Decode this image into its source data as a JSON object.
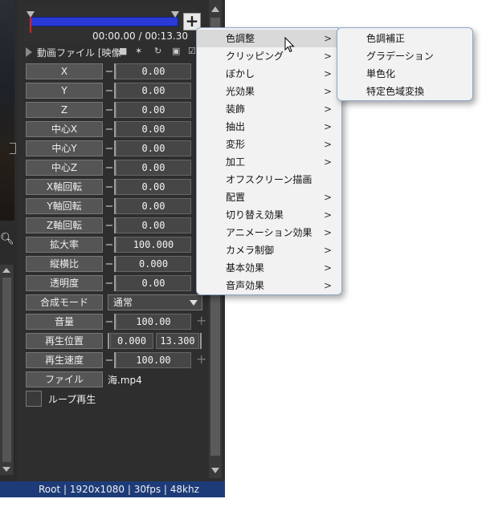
{
  "timeline": {
    "time": "00:00.00 / 00:13.30"
  },
  "object": {
    "title": "動画ファイル [映像"
  },
  "properties": [
    {
      "label": "X",
      "value": "0.00"
    },
    {
      "label": "Y",
      "value": "0.00"
    },
    {
      "label": "Z",
      "value": "0.00"
    },
    {
      "label": "中心X",
      "value": "0.00"
    },
    {
      "label": "中心Y",
      "value": "0.00"
    },
    {
      "label": "中心Z",
      "value": "0.00"
    },
    {
      "label": "X軸回転",
      "value": "0.00"
    },
    {
      "label": "Y軸回転",
      "value": "0.00"
    },
    {
      "label": "Z軸回転",
      "value": "0.00"
    },
    {
      "label": "拡大率",
      "value": "100.000"
    },
    {
      "label": "縦横比",
      "value": "0.000"
    },
    {
      "label": "透明度",
      "value": "0.00"
    }
  ],
  "blend": {
    "label": "合成モード",
    "value": "通常"
  },
  "volume": {
    "label": "音量",
    "value": "100.00"
  },
  "playpos": {
    "label": "再生位置",
    "start": "0.000",
    "end": "13.300"
  },
  "speed": {
    "label": "再生速度",
    "value": "100.00"
  },
  "file": {
    "label": "ファイル",
    "name": "海.mp4"
  },
  "loop": {
    "label": "ループ再生"
  },
  "status": "Root  |  1920x1080  |  30fps  |  48khz",
  "menu": {
    "items": [
      {
        "label": "色調整",
        "sub": true
      },
      {
        "label": "クリッピング",
        "sub": true
      },
      {
        "label": "ぼかし",
        "sub": true
      },
      {
        "label": "光効果",
        "sub": true
      },
      {
        "label": "装飾",
        "sub": true
      },
      {
        "label": "抽出",
        "sub": true
      },
      {
        "label": "変形",
        "sub": true
      },
      {
        "label": "加工",
        "sub": true
      },
      {
        "label": "オフスクリーン描画",
        "sub": false
      },
      {
        "label": "配置",
        "sub": true
      },
      {
        "label": "切り替え効果",
        "sub": true
      },
      {
        "label": "アニメーション効果",
        "sub": true
      },
      {
        "label": "カメラ制御",
        "sub": true
      },
      {
        "label": "基本効果",
        "sub": true
      },
      {
        "label": "音声効果",
        "sub": true
      }
    ],
    "chevron": ">"
  },
  "submenu": {
    "items": [
      "色調補正",
      "グラデーション",
      "単色化",
      "特定色域変換"
    ]
  }
}
